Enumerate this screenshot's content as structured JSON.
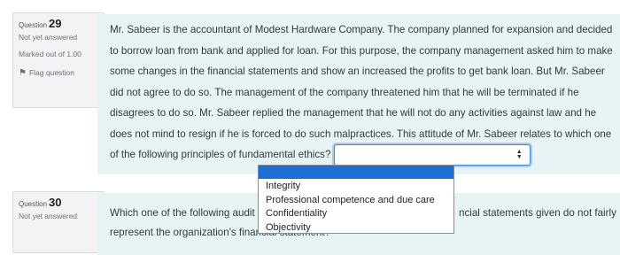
{
  "question29": {
    "label": "Question",
    "number": "29",
    "state": "Not yet answered",
    "grade": "Marked out of 1.00",
    "flag_label": "Flag question",
    "text": "Mr. Sabeer is the accountant of Modest Hardware Company. The company planned for expansion and decided to borrow loan from bank and applied for loan. For this purpose, the company management asked him to make some changes in the financial statements and show an increased the profits to get bank loan. But Mr. Sabeer did not agree to do so. The management of the company threatened him that he will be terminated if he disagrees to do so. Mr. Sabeer replied the management that he will not do any activities against law and he does not mind to resign if he is forced to do such malpractices.  This attitude of Mr. Sabeer relates to which one of the following principles of fundamental ethics?",
    "selected_value": "",
    "options": [
      "Integrity",
      "Professional competence and due care",
      "Confidentiality",
      "Objectivity"
    ]
  },
  "question30": {
    "label": "Question",
    "number": "30",
    "state": "Not yet answered",
    "text_start": "Which one of the following audit",
    "text_end": "ncial statements given do not fairly",
    "text_line2": "represent the organization's financial statement?"
  }
}
